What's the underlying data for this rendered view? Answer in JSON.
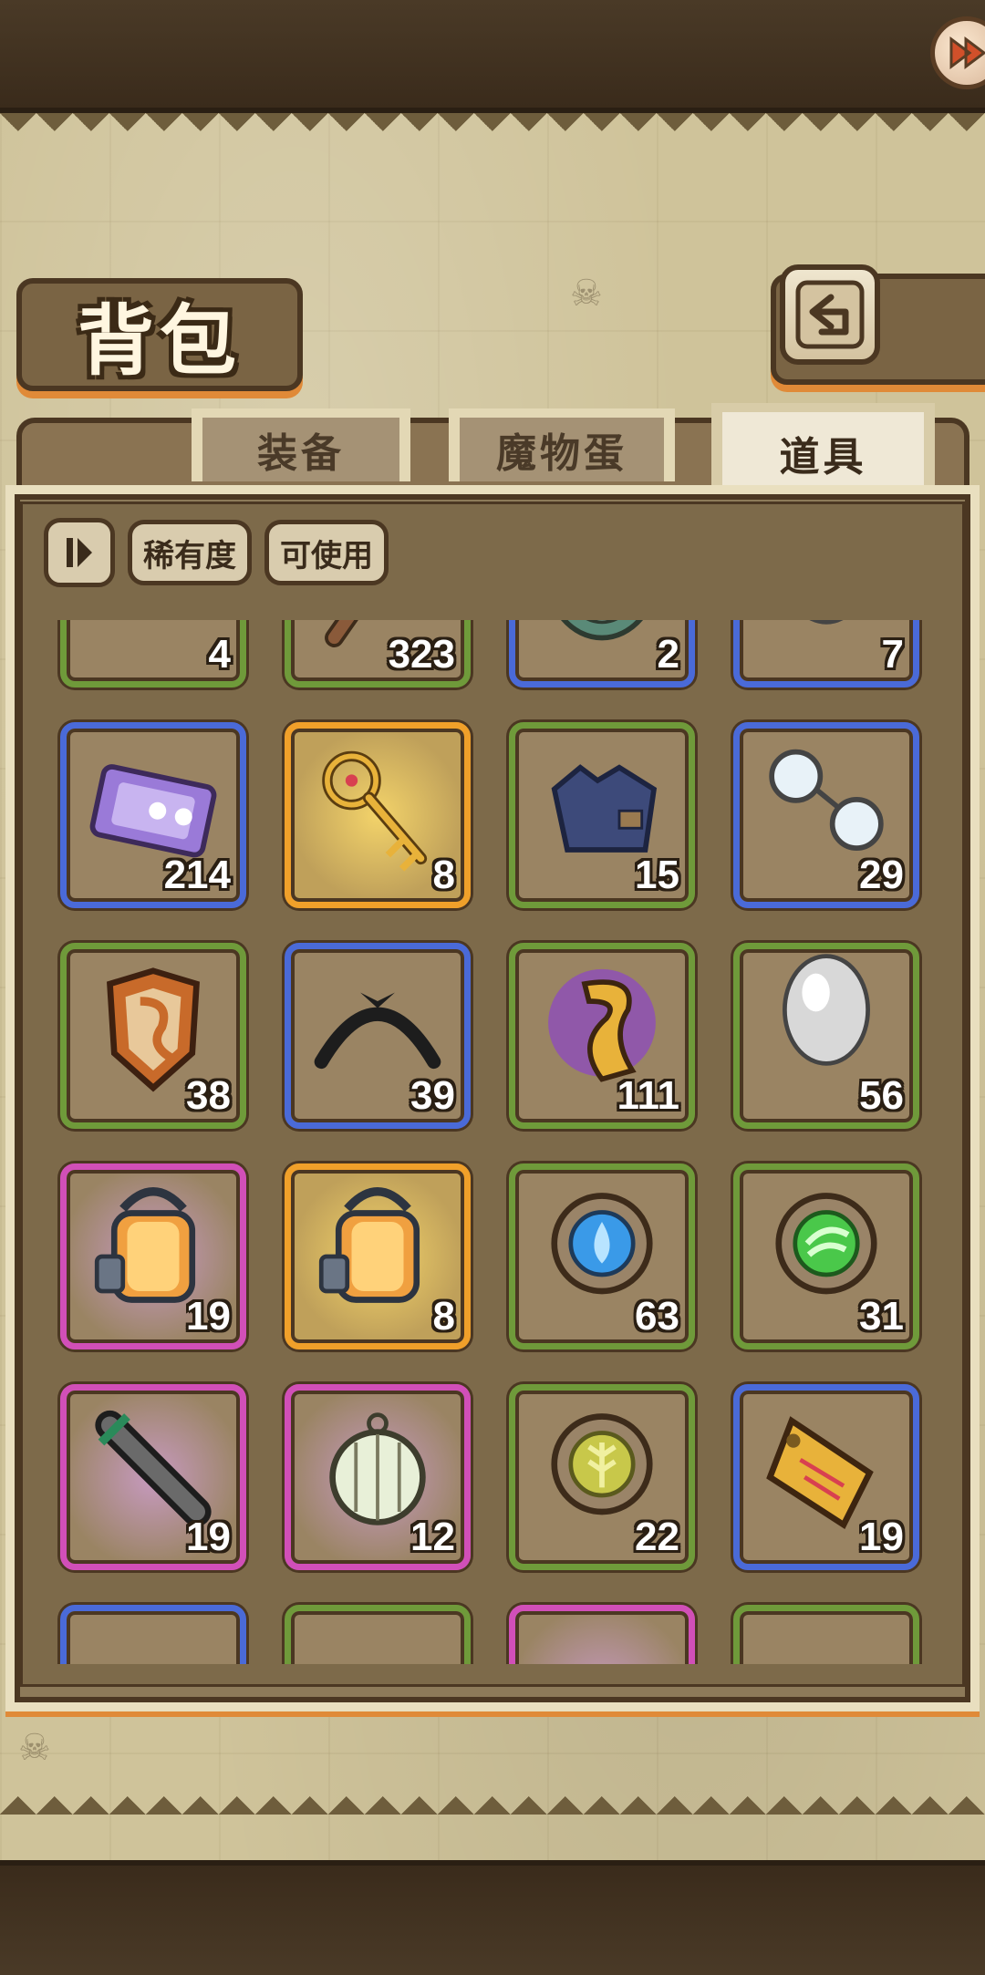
{
  "header": {
    "title": "背包"
  },
  "tabs": [
    {
      "label": "装备",
      "active": false
    },
    {
      "label": "魔物蛋",
      "active": false
    },
    {
      "label": "道具",
      "active": true
    }
  ],
  "filters": {
    "rarity_label": "稀有度",
    "usable_label": "可使用"
  },
  "items": [
    {
      "name": "beans",
      "rarity": "green",
      "count": "4",
      "icon": "beans-icon"
    },
    {
      "name": "pickaxe",
      "rarity": "green",
      "count": "323",
      "icon": "pickaxe-icon"
    },
    {
      "name": "rune-shield",
      "rarity": "blue",
      "count": "2",
      "icon": "rune-disc-icon"
    },
    {
      "name": "silver-egg",
      "rarity": "blue",
      "count": "7",
      "icon": "egg-icon"
    },
    {
      "name": "ticket",
      "rarity": "blue",
      "count": "214",
      "icon": "ticket-icon"
    },
    {
      "name": "golden-key",
      "rarity": "orange",
      "count": "8",
      "icon": "key-icon"
    },
    {
      "name": "cloth",
      "rarity": "green",
      "count": "15",
      "icon": "cloth-icon"
    },
    {
      "name": "glasses",
      "rarity": "blue",
      "count": "29",
      "icon": "glasses-icon"
    },
    {
      "name": "dragon-shield",
      "rarity": "green",
      "count": "38",
      "icon": "shield-icon"
    },
    {
      "name": "headband",
      "rarity": "blue",
      "count": "39",
      "icon": "headband-icon"
    },
    {
      "name": "dragon-emblem",
      "rarity": "green",
      "count": "111",
      "icon": "dragon-emblem-icon"
    },
    {
      "name": "yellow-egg",
      "rarity": "green",
      "count": "56",
      "icon": "egg-icon"
    },
    {
      "name": "red-lantern",
      "rarity": "pink",
      "count": "19",
      "icon": "lantern-icon"
    },
    {
      "name": "rainbow-lantern",
      "rarity": "orange",
      "count": "8",
      "icon": "lantern-icon"
    },
    {
      "name": "water-rune",
      "rarity": "green",
      "count": "63",
      "icon": "water-rune-icon"
    },
    {
      "name": "wind-rune",
      "rarity": "green",
      "count": "31",
      "icon": "wind-rune-icon"
    },
    {
      "name": "broken-sword",
      "rarity": "pink",
      "count": "19",
      "icon": "sword-icon"
    },
    {
      "name": "lamp",
      "rarity": "pink",
      "count": "12",
      "icon": "lamp-icon"
    },
    {
      "name": "earth-rune",
      "rarity": "green",
      "count": "22",
      "icon": "earth-rune-icon"
    },
    {
      "name": "bone-tag",
      "rarity": "blue",
      "count": "19",
      "icon": "tag-icon"
    },
    {
      "name": "partial-1",
      "rarity": "blue",
      "count": "",
      "icon": ""
    },
    {
      "name": "partial-2",
      "rarity": "green",
      "count": "",
      "icon": ""
    },
    {
      "name": "partial-3",
      "rarity": "pink",
      "count": "",
      "icon": ""
    },
    {
      "name": "partial-4",
      "rarity": "green",
      "count": "",
      "icon": ""
    }
  ]
}
